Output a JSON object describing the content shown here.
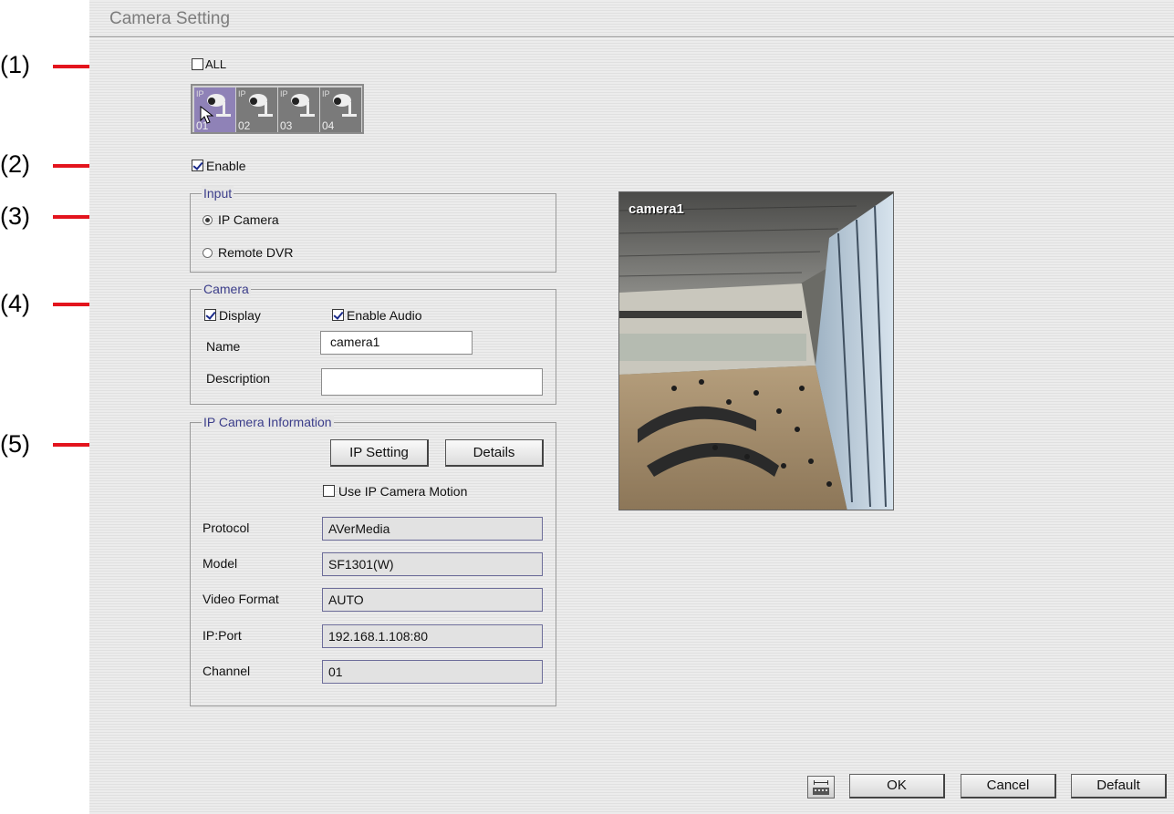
{
  "window": {
    "title": "Camera Setting"
  },
  "annotations": [
    "(1)",
    "(2)",
    "(3)",
    "(4)",
    "(5)"
  ],
  "all_checkbox": {
    "label": "ALL",
    "checked": false
  },
  "cameras": [
    {
      "tag": "IP",
      "number": "01",
      "selected": true
    },
    {
      "tag": "IP",
      "number": "02",
      "selected": false
    },
    {
      "tag": "IP",
      "number": "03",
      "selected": false
    },
    {
      "tag": "IP",
      "number": "04",
      "selected": false
    }
  ],
  "enable": {
    "label": "Enable",
    "checked": true
  },
  "input_group": {
    "title": "Input",
    "options": [
      {
        "label": "IP Camera",
        "selected": true
      },
      {
        "label": "Remote DVR",
        "selected": false
      }
    ]
  },
  "camera_group": {
    "title": "Camera",
    "display_label": "Display",
    "display_checked": true,
    "audio_label": "Enable Audio",
    "audio_checked": true,
    "name_label": "Name",
    "name_value": "camera1",
    "description_label": "Description",
    "description_value": ""
  },
  "ipcam_group": {
    "title": "IP Camera Information",
    "ip_setting_label": "IP Setting",
    "details_label": "Details",
    "motion_label": "Use IP Camera Motion",
    "motion_checked": false,
    "fields": [
      {
        "label": "Protocol",
        "value": "AVerMedia"
      },
      {
        "label": "Model",
        "value": "SF1301(W)"
      },
      {
        "label": "Video Format",
        "value": "AUTO"
      },
      {
        "label": "IP:Port",
        "value": "192.168.1.108:80"
      },
      {
        "label": "Channel",
        "value": "01"
      }
    ]
  },
  "preview": {
    "label": "camera1"
  },
  "footer": {
    "keyboard_icon": "keyboard-icon",
    "ok_label": "OK",
    "cancel_label": "Cancel",
    "default_label": "Default"
  },
  "colors": {
    "annotation_line": "#e3141d",
    "group_title": "#3b3d8a",
    "selected_tile": "#8f82b7"
  }
}
